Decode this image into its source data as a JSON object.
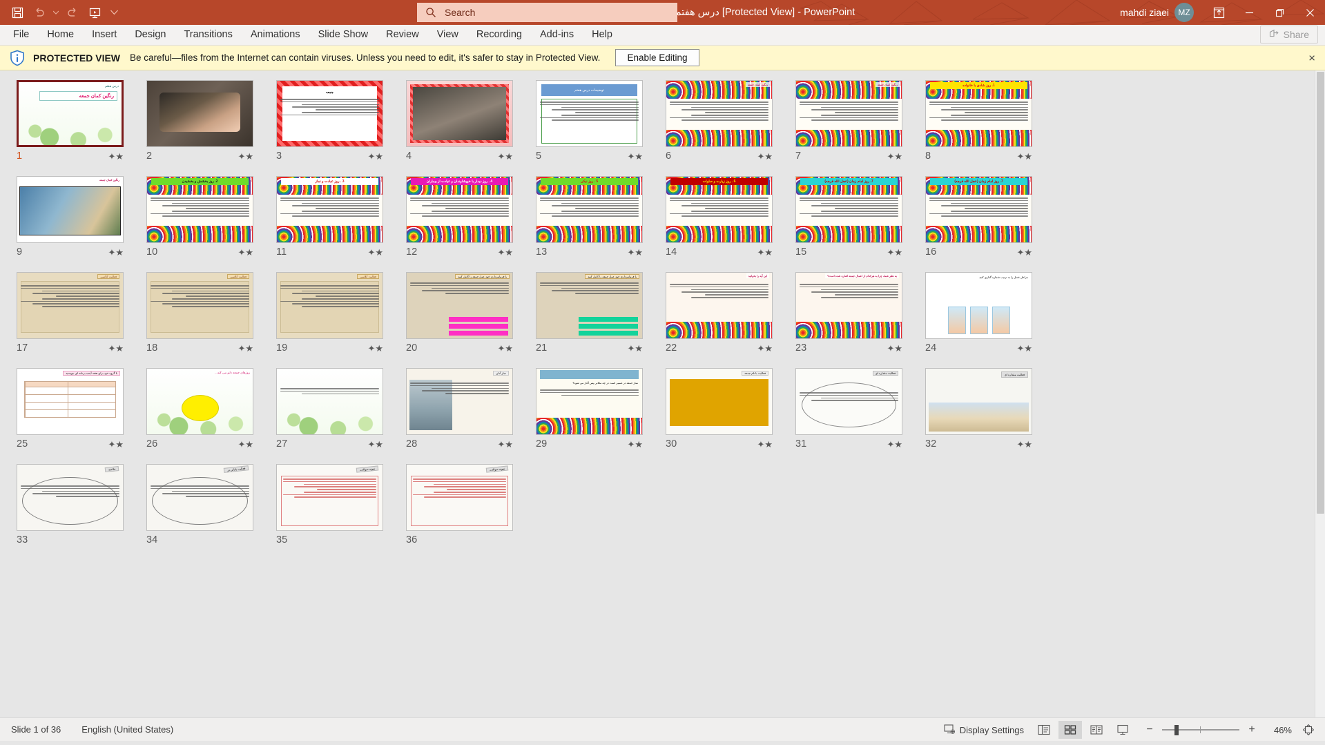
{
  "window": {
    "title_rtl": "درس هفتم هدیه، رنگین کمان جمعه ها",
    "title_suffix": "[Protected View]  -  PowerPoint",
    "accent_color": "#b7472a",
    "minimize_label": "Minimize",
    "restore_label": "Restore Down",
    "close_label": "Close",
    "ribbon_display_label": "Ribbon Display Options"
  },
  "quick_access": {
    "save_label": "Save",
    "undo_label": "Undo",
    "undo_dropdown_label": "Undo dropdown",
    "redo_label": "Repeat",
    "present_label": "Start From Beginning",
    "customize_label": "Customize Quick Access Toolbar"
  },
  "search": {
    "placeholder": "Search",
    "icon": "search-icon"
  },
  "account": {
    "user_name": "mahdi ziaei",
    "initials": "MZ"
  },
  "ribbon": {
    "tabs": [
      {
        "label": "File"
      },
      {
        "label": "Home"
      },
      {
        "label": "Insert"
      },
      {
        "label": "Design"
      },
      {
        "label": "Transitions"
      },
      {
        "label": "Animations"
      },
      {
        "label": "Slide Show"
      },
      {
        "label": "Review"
      },
      {
        "label": "View"
      },
      {
        "label": "Recording"
      },
      {
        "label": "Add-ins"
      },
      {
        "label": "Help"
      }
    ],
    "share_label": "Share"
  },
  "protected_view": {
    "title": "PROTECTED VIEW",
    "message": "Be careful—files from the Internet can contain viruses. Unless you need to edit, it's safer to stay in Protected View.",
    "enable_label": "Enable Editing",
    "close_label": "×",
    "background_color": "#fff8cc"
  },
  "status_bar": {
    "slide_counter": "Slide 1 of 36",
    "language": "English (United States)",
    "display_settings": "Display Settings",
    "zoom_level": "46%",
    "views": [
      {
        "name": "normal-view",
        "label": "Normal"
      },
      {
        "name": "slide-sorter-view",
        "label": "Slide Sorter"
      },
      {
        "name": "reading-view",
        "label": "Reading View"
      },
      {
        "name": "slide-show-view",
        "label": "Slide Show"
      }
    ],
    "active_view": "slide-sorter-view",
    "zoom_out_label": "Zoom Out",
    "zoom_in_label": "Zoom In",
    "fit_label": "Fit slide to current window"
  },
  "sorter": {
    "selected_slide": 1,
    "total_slides": 36,
    "lesson_label": "درس هفتم",
    "lesson_title": "رنگین کمان جمعه",
    "slides": [
      {
        "n": 1,
        "kind": "title",
        "anim": true,
        "selected": true,
        "heading": "رنگین کمان جمعه",
        "eyebrow": "درس هفتم"
      },
      {
        "n": 2,
        "kind": "photo",
        "anim": true,
        "heading": ""
      },
      {
        "n": 3,
        "kind": "redframe",
        "anim": true,
        "heading": "جمعه"
      },
      {
        "n": 4,
        "kind": "photo2",
        "anim": true,
        "heading": ""
      },
      {
        "n": 5,
        "kind": "bluebox",
        "anim": true,
        "heading": "توضیحات درس هفتم"
      },
      {
        "n": 6,
        "kind": "rainbow",
        "anim": true,
        "heading": "رنگین کمان جمعه"
      },
      {
        "n": 7,
        "kind": "rainbow",
        "anim": true,
        "heading": "رنگین کمان جمعه"
      },
      {
        "n": 8,
        "kind": "rainbow-banner",
        "anim": true,
        "banner": "1. روز شادي با خانواده",
        "banner_bg": "#ffe400",
        "banner_fg": "#d31212"
      },
      {
        "n": 9,
        "kind": "photo3",
        "anim": true,
        "heading": "رنگین کمان جمعه"
      },
      {
        "n": 10,
        "kind": "rainbow-banner",
        "anim": true,
        "banner": "2. روز بخشش و بخشیدن",
        "banner_bg": "#6fdc2a",
        "banner_fg": "#1a1a1a"
      },
      {
        "n": 11,
        "kind": "rainbow-banner",
        "anim": true,
        "banner": "3 . روز عبادت و نماز",
        "banner_bg": "#ffffff",
        "banner_fg": "#d31212"
      },
      {
        "n": 12,
        "kind": "rainbow-banner",
        "anim": true,
        "banner": "4 . روز دیدار با خویشاوندان و عیادت از بیماران",
        "banner_bg": "#e81ab5",
        "banner_fg": "#ffffff"
      },
      {
        "n": 13,
        "kind": "rainbow-banner",
        "anim": true,
        "banner": "5 . روز نیکی",
        "banner_bg": "#6fdc2a",
        "banner_fg": "#d31212"
      },
      {
        "n": 14,
        "kind": "rainbow-banner",
        "anim": true,
        "banner": "6 . روز زیارت و صلوات",
        "banner_bg": "#c00000",
        "banner_fg": "#ffe400"
      },
      {
        "n": 15,
        "kind": "rainbow-banner",
        "anim": true,
        "banner": "7. روز امام زمان (عجل الله فرجه)",
        "banner_bg": "#2ad4d4",
        "banner_fg": "#c00000"
      },
      {
        "n": 16,
        "kind": "rainbow-banner",
        "anim": true,
        "banner": "7. روز امام زمان (عجل الله فرجه)",
        "banner_bg": "#2ad4d4",
        "banner_fg": "#c00000"
      },
      {
        "n": 17,
        "kind": "paper",
        "anim": true,
        "heading": "فعالیت کلاسی"
      },
      {
        "n": 18,
        "kind": "paper",
        "anim": true,
        "heading": "فعالیت کلاسی"
      },
      {
        "n": 19,
        "kind": "paper",
        "anim": true,
        "heading": "فعالیت کلاسی"
      },
      {
        "n": 20,
        "kind": "quiz-pink",
        "anim": true,
        "heading": "با فرمانبرداری خود عمل جمعه را کامل کنید"
      },
      {
        "n": 21,
        "kind": "quiz-green",
        "anim": true,
        "heading": "با فرمانبرداری خود عمل جمعه را کامل کنید"
      },
      {
        "n": 22,
        "kind": "rainbow-soft",
        "anim": true,
        "heading": "این آیه را بخوانید"
      },
      {
        "n": 23,
        "kind": "rainbow-soft",
        "anim": true,
        "heading": "به نظر شما، چرا به هرکدام از اعمال جمعه اشاره شده است؟"
      },
      {
        "n": 24,
        "kind": "kids",
        "anim": true,
        "heading": "مراحل غسل را به ترتیب شماره گذاری کنید"
      },
      {
        "n": 25,
        "kind": "table",
        "anim": true,
        "heading": "با گروه خود برای هفته آینده برنامه ای بنویسید"
      },
      {
        "n": 26,
        "kind": "yellowdot",
        "anim": true,
        "heading": "روزهای جمعه دلم می کند..."
      },
      {
        "n": 27,
        "kind": "floral",
        "anim": true,
        "heading": ""
      },
      {
        "n": 28,
        "kind": "mosque",
        "anim": true,
        "heading": "نماز آدان"
      },
      {
        "n": 29,
        "kind": "rainbow-q",
        "anim": true,
        "heading": "نماز جمعه در ضمیر است در چه مکانی پس آغاز می شود؟"
      },
      {
        "n": 30,
        "kind": "gold",
        "anim": true,
        "heading": "فعالیت با نام جمعه"
      },
      {
        "n": 31,
        "kind": "oval",
        "anim": true,
        "heading": "فعالیت مقداره ای"
      },
      {
        "n": 32,
        "kind": "photo4",
        "anim": true,
        "heading": "فعالیت مقداره ای"
      },
      {
        "n": 33,
        "kind": "oval2",
        "anim": false,
        "heading": "خلاصه"
      },
      {
        "n": 34,
        "kind": "oval2",
        "anim": false,
        "heading": "فعالیت پایانی در"
      },
      {
        "n": 35,
        "kind": "exam",
        "anim": false,
        "heading": "نمونه سوالات"
      },
      {
        "n": 36,
        "kind": "exam",
        "anim": false,
        "heading": "نمونه سوالات"
      }
    ]
  }
}
